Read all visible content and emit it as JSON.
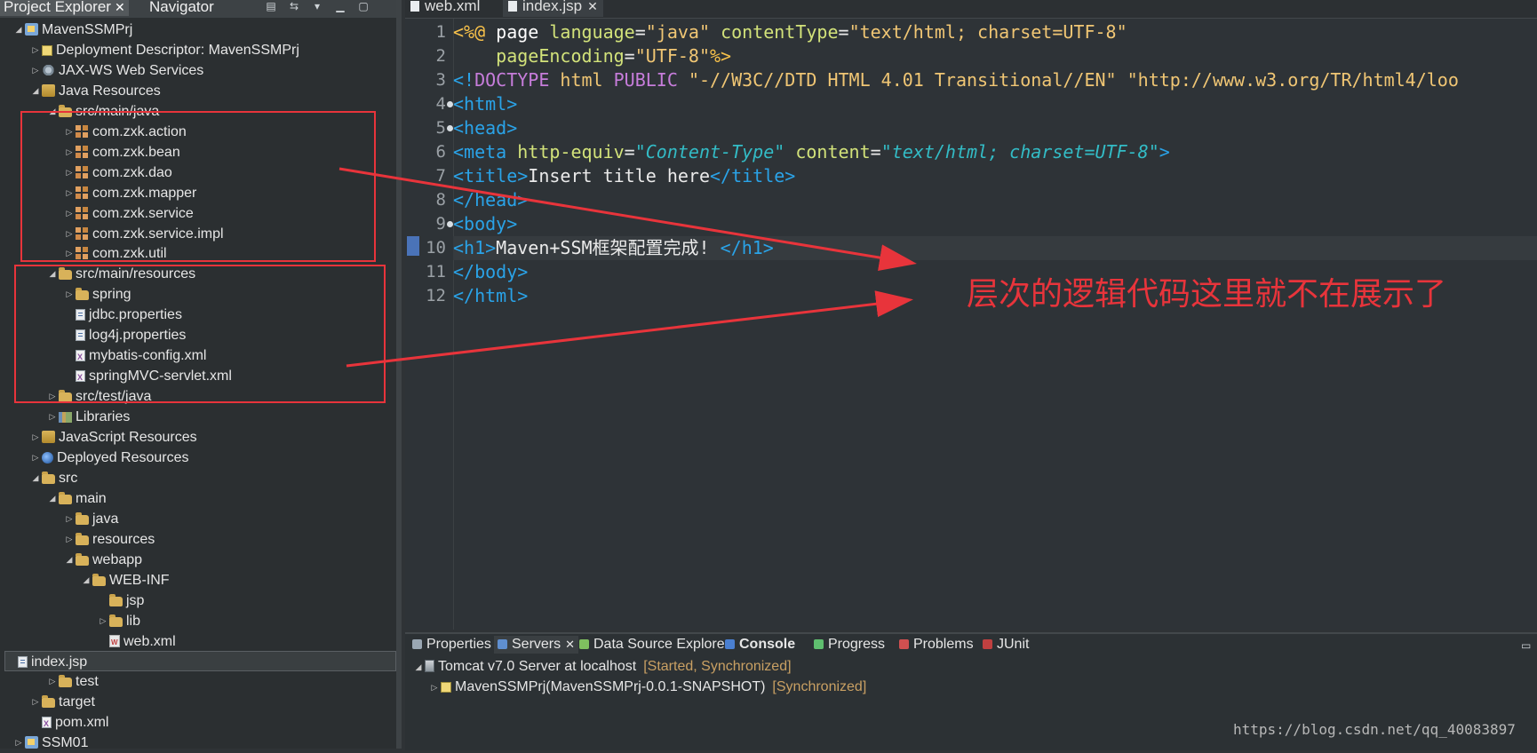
{
  "left_tabs": [
    {
      "label": "Project Explorer",
      "active": true
    },
    {
      "label": "Navigator",
      "active": false
    }
  ],
  "tree": [
    {
      "label": "MavenSSMPrj",
      "level": 0,
      "icon": "project",
      "toggle": "expanded"
    },
    {
      "label": "Deployment Descriptor: MavenSSMPrj",
      "level": 1,
      "icon": "module",
      "toggle": "collapsed"
    },
    {
      "label": "JAX-WS Web Services",
      "level": 1,
      "icon": "gear",
      "toggle": "collapsed"
    },
    {
      "label": "Java Resources",
      "level": 1,
      "icon": "jar",
      "toggle": "expanded"
    },
    {
      "label": "src/main/java",
      "level": 2,
      "icon": "folder",
      "toggle": "expanded"
    },
    {
      "label": "com.zxk.action",
      "level": 3,
      "icon": "package",
      "toggle": "collapsed"
    },
    {
      "label": "com.zxk.bean",
      "level": 3,
      "icon": "package",
      "toggle": "collapsed"
    },
    {
      "label": "com.zxk.dao",
      "level": 3,
      "icon": "package",
      "toggle": "collapsed"
    },
    {
      "label": "com.zxk.mapper",
      "level": 3,
      "icon": "package",
      "toggle": "collapsed"
    },
    {
      "label": "com.zxk.service",
      "level": 3,
      "icon": "package",
      "toggle": "collapsed"
    },
    {
      "label": "com.zxk.service.impl",
      "level": 3,
      "icon": "package",
      "toggle": "collapsed"
    },
    {
      "label": "com.zxk.util",
      "level": 3,
      "icon": "package",
      "toggle": "collapsed"
    },
    {
      "label": "src/main/resources",
      "level": 2,
      "icon": "folder",
      "toggle": "expanded"
    },
    {
      "label": "spring",
      "level": 3,
      "icon": "folder",
      "toggle": "collapsed"
    },
    {
      "label": "jdbc.properties",
      "level": 3,
      "icon": "file",
      "toggle": "none"
    },
    {
      "label": "log4j.properties",
      "level": 3,
      "icon": "file",
      "toggle": "none"
    },
    {
      "label": "mybatis-config.xml",
      "level": 3,
      "icon": "xml",
      "toggle": "none"
    },
    {
      "label": "springMVC-servlet.xml",
      "level": 3,
      "icon": "xml",
      "toggle": "none"
    },
    {
      "label": "src/test/java",
      "level": 2,
      "icon": "folder",
      "toggle": "collapsed"
    },
    {
      "label": "Libraries",
      "level": 2,
      "icon": "library",
      "toggle": "collapsed"
    },
    {
      "label": "JavaScript Resources",
      "level": 1,
      "icon": "jar",
      "toggle": "collapsed"
    },
    {
      "label": "Deployed Resources",
      "level": 1,
      "icon": "globe",
      "toggle": "collapsed"
    },
    {
      "label": "src",
      "level": 1,
      "icon": "folder",
      "toggle": "expanded"
    },
    {
      "label": "main",
      "level": 2,
      "icon": "folder",
      "toggle": "expanded"
    },
    {
      "label": "java",
      "level": 3,
      "icon": "folder",
      "toggle": "collapsed"
    },
    {
      "label": "resources",
      "level": 3,
      "icon": "folder",
      "toggle": "collapsed"
    },
    {
      "label": "webapp",
      "level": 3,
      "icon": "folder",
      "toggle": "expanded"
    },
    {
      "label": "WEB-INF",
      "level": 4,
      "icon": "folder",
      "toggle": "expanded"
    },
    {
      "label": "jsp",
      "level": 5,
      "icon": "folder",
      "toggle": "none"
    },
    {
      "label": "lib",
      "level": 5,
      "icon": "folder",
      "toggle": "collapsed"
    },
    {
      "label": "web.xml",
      "level": 5,
      "icon": "webxml",
      "toggle": "none"
    },
    {
      "label": "index.jsp",
      "level": 4,
      "icon": "file",
      "toggle": "none",
      "selected": true
    },
    {
      "label": "test",
      "level": 2,
      "icon": "folder",
      "toggle": "collapsed"
    },
    {
      "label": "target",
      "level": 1,
      "icon": "folder",
      "toggle": "collapsed"
    },
    {
      "label": "pom.xml",
      "level": 1,
      "icon": "xml",
      "toggle": "none"
    },
    {
      "label": "SSM01",
      "level": 0,
      "icon": "project",
      "toggle": "collapsed"
    }
  ],
  "editor_tabs": [
    {
      "label": "web.xml",
      "active": false
    },
    {
      "label": "index.jsp",
      "active": true
    }
  ],
  "code_lines": [
    {
      "n": "1",
      "fold": false,
      "tokens": [
        [
          "dir",
          "<%@ "
        ],
        [
          "kw",
          "page "
        ],
        [
          "attr",
          "language"
        ],
        [
          "txt",
          "="
        ],
        [
          "str",
          "\"java\""
        ],
        [
          "txt",
          " "
        ],
        [
          "attr",
          "contentType"
        ],
        [
          "txt",
          "="
        ],
        [
          "str",
          "\"text/html; charset=UTF-8\""
        ]
      ]
    },
    {
      "n": "2",
      "fold": false,
      "tokens": [
        [
          "txt",
          "    "
        ],
        [
          "attr",
          "pageEncoding"
        ],
        [
          "txt",
          "="
        ],
        [
          "str",
          "\"UTF-8\""
        ],
        [
          "dir",
          "%>"
        ]
      ]
    },
    {
      "n": "3",
      "fold": false,
      "tokens": [
        [
          "tag",
          "<!"
        ],
        [
          "doct",
          "DOCTYPE "
        ],
        [
          "str",
          "html "
        ],
        [
          "doct",
          "PUBLIC "
        ],
        [
          "str",
          "\"-//W3C//DTD HTML 4.01 Transitional//EN\" \"http://www.w3.org/TR/html4/loo"
        ]
      ]
    },
    {
      "n": "4",
      "fold": true,
      "tokens": [
        [
          "tag",
          "<html>"
        ]
      ]
    },
    {
      "n": "5",
      "fold": true,
      "tokens": [
        [
          "tag",
          "<head>"
        ]
      ]
    },
    {
      "n": "6",
      "fold": false,
      "tokens": [
        [
          "tag",
          "<meta "
        ],
        [
          "attr",
          "http-equiv"
        ],
        [
          "txt",
          "="
        ],
        [
          "it",
          "\"Content-Type\""
        ],
        [
          "txt",
          " "
        ],
        [
          "attr",
          "content"
        ],
        [
          "txt",
          "="
        ],
        [
          "it",
          "\"text/html; charset=UTF-8\""
        ],
        [
          "tag",
          ">"
        ]
      ]
    },
    {
      "n": "7",
      "fold": false,
      "tokens": [
        [
          "tag",
          "<title>"
        ],
        [
          "txt",
          "Insert title here"
        ],
        [
          "tag",
          "</title>"
        ]
      ]
    },
    {
      "n": "8",
      "fold": false,
      "tokens": [
        [
          "tag",
          "</head>"
        ]
      ]
    },
    {
      "n": "9",
      "fold": true,
      "tokens": [
        [
          "tag",
          "<body>"
        ]
      ]
    },
    {
      "n": "10",
      "fold": false,
      "current": true,
      "tokens": [
        [
          "tag",
          "<h1>"
        ],
        [
          "txt",
          "Maven+SSM框架配置完成! "
        ],
        [
          "tag",
          "</h1>"
        ]
      ]
    },
    {
      "n": "11",
      "fold": false,
      "tokens": [
        [
          "tag",
          "</body>"
        ]
      ]
    },
    {
      "n": "12",
      "fold": false,
      "tokens": [
        [
          "tag",
          "</html>"
        ]
      ]
    }
  ],
  "bottom_tabs": [
    {
      "label": "Properties",
      "active": false,
      "color": "#9aa7b3"
    },
    {
      "label": "Servers",
      "active": true,
      "color": "#5f8fd0"
    },
    {
      "label": "Data Source Explorer",
      "active": false,
      "color": "#7fbf5f"
    },
    {
      "label": "Console",
      "active": false,
      "color": "#4a7fd0"
    },
    {
      "label": "Progress",
      "active": false,
      "color": "#5fbf6f"
    },
    {
      "label": "Problems",
      "active": false,
      "color": "#d05050"
    },
    {
      "label": "JUnit",
      "active": false,
      "color": "#c04040"
    }
  ],
  "servers": [
    {
      "label": "Tomcat v7.0 Server at localhost",
      "status": "[Started, Synchronized]",
      "level": 0,
      "toggle": "expanded"
    },
    {
      "label": "MavenSSMPrj(MavenSSMPrj-0.0.1-SNAPSHOT)",
      "status": "[Synchronized]",
      "level": 1,
      "toggle": "collapsed"
    }
  ],
  "annotation_text": "层次的逻辑代码这里就不在展示了",
  "watermark": "https://blog.csdn.net/qq_40083897",
  "colors": {
    "annotation_red": "#e8343b",
    "tag_blue": "#2aa3e8",
    "attr_yellow": "#d2e27a"
  }
}
